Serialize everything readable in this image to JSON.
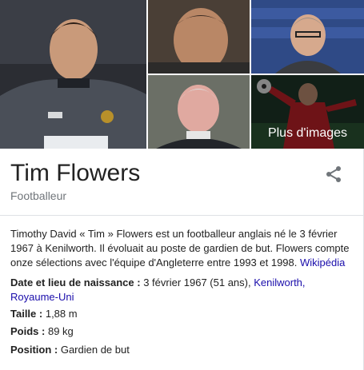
{
  "knowledge_panel": {
    "more_images_label": "Plus d'images",
    "title": "Tim Flowers",
    "subtitle": "Footballeur",
    "description": "Timothy David « Tim » Flowers est un footballeur anglais né le 3 février 1967 à Kenilworth. Il évoluait au poste de gardien de but. Flowers compte onze sélections avec l'équipe d'Angleterre entre 1993 et 1998.",
    "description_link": "Wikipédia",
    "facts": {
      "birth": {
        "label": "Date et lieu de naissance",
        "value": "3 février 1967 (51 ans),",
        "link1": "Kenilworth,",
        "link2": "Royaume-Uni"
      },
      "height": {
        "label": "Taille",
        "value": "1,88 m"
      },
      "weight": {
        "label": "Poids",
        "value": "89 kg"
      },
      "position": {
        "label": "Position",
        "value": "Gardien de but"
      }
    },
    "icons": {
      "share": "share-icon"
    },
    "colors": {
      "link": "#1a0dab",
      "muted": "#70757a",
      "text": "#222222"
    }
  }
}
